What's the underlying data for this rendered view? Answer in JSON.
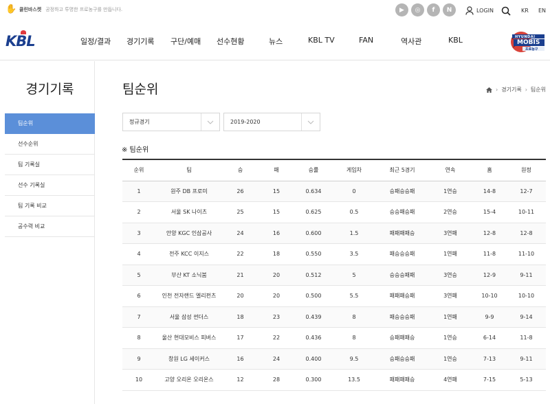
{
  "topbar": {
    "clean_label": "클린바스켓",
    "clean_desc": "공정하고 투명한 프로농구를 만듭니다.",
    "social": [
      "YouTube",
      "Instagram",
      "Facebook",
      "Naver"
    ],
    "login": "LOGIN",
    "lang": [
      "KR",
      "EN"
    ]
  },
  "header": {
    "logo": "KBL",
    "nav": [
      "일정/결과",
      "경기기록",
      "구단/예매",
      "선수현황",
      "뉴스",
      "KBL TV",
      "FAN",
      "역사관",
      "KBL"
    ],
    "sponsor": {
      "line1": "HYUNDAI",
      "line2": "MOBIS",
      "line3": "프로농구"
    }
  },
  "sidebar": {
    "title": "경기기록",
    "items": [
      "팀순위",
      "선수순위",
      "팀 기록실",
      "선수 기록실",
      "팀 기록 비교",
      "공수력 비교"
    ]
  },
  "main": {
    "title": "팀순위",
    "breadcrumb": [
      "경기기록",
      "팀순위"
    ],
    "filters": {
      "game_type": "정규경기",
      "season": "2019-2020"
    },
    "section_title": "※ 팀순위",
    "columns": [
      "순위",
      "팀",
      "승",
      "패",
      "승률",
      "게임차",
      "최근 5경기",
      "연속",
      "홈",
      "원정"
    ],
    "rows": [
      [
        "1",
        "원주 DB 프로미",
        "26",
        "15",
        "0.634",
        "0",
        "승패승승패",
        "1연승",
        "14-8",
        "12-7"
      ],
      [
        "2",
        "서울 SK 나이츠",
        "25",
        "15",
        "0.625",
        "0.5",
        "승승패승패",
        "2연승",
        "15-4",
        "10-11"
      ],
      [
        "3",
        "안양 KGC 인삼공사",
        "24",
        "16",
        "0.600",
        "1.5",
        "패패패패승",
        "3연패",
        "12-8",
        "12-8"
      ],
      [
        "4",
        "전주 KCC 이지스",
        "22",
        "18",
        "0.550",
        "3.5",
        "패승승승패",
        "1연패",
        "11-8",
        "11-10"
      ],
      [
        "5",
        "부산 KT 소닉붐",
        "21",
        "20",
        "0.512",
        "5",
        "승승승패패",
        "3연승",
        "12-9",
        "9-11"
      ],
      [
        "6",
        "인천 전자랜드 엘리펀츠",
        "20",
        "20",
        "0.500",
        "5.5",
        "패패패승패",
        "3연패",
        "10-10",
        "10-10"
      ],
      [
        "7",
        "서울 삼성 썬더스",
        "18",
        "23",
        "0.439",
        "8",
        "패승승승패",
        "1연패",
        "9-9",
        "9-14"
      ],
      [
        "8",
        "울산 현대모비스 피버스",
        "17",
        "22",
        "0.436",
        "8",
        "승패패패승",
        "1연승",
        "6-14",
        "11-8"
      ],
      [
        "9",
        "창원 LG 세이커스",
        "16",
        "24",
        "0.400",
        "9.5",
        "승패승승패",
        "1연승",
        "7-13",
        "9-11"
      ],
      [
        "10",
        "고양 오리온 오리온스",
        "12",
        "28",
        "0.300",
        "13.5",
        "패패패패승",
        "4연패",
        "7-15",
        "5-13"
      ]
    ]
  },
  "colors": {
    "accent": "#5b8fd9",
    "logo_blue": "#1b3f8f",
    "logo_red": "#e03a3e"
  }
}
